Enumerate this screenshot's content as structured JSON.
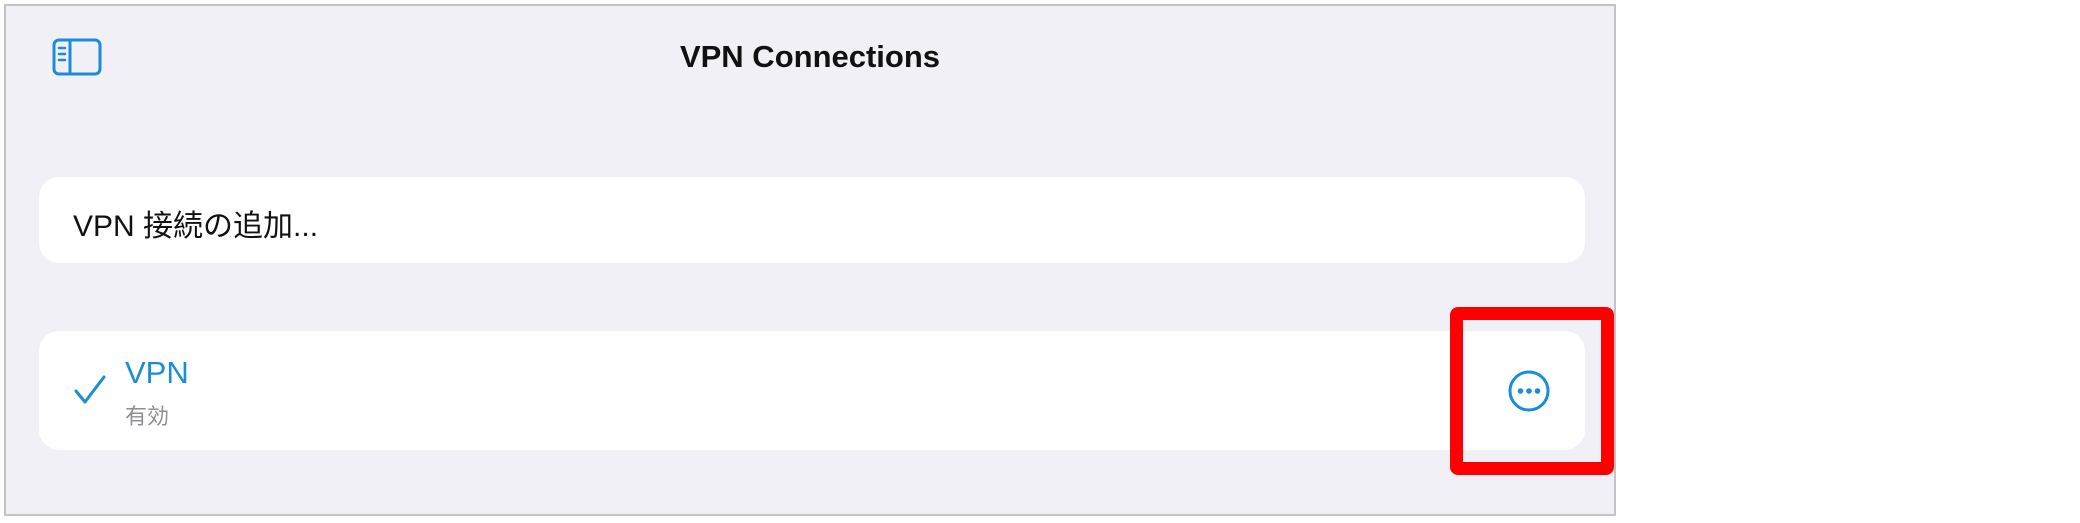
{
  "header": {
    "title": "VPN Connections",
    "sidebar_icon": "sidebar-toggle-icon"
  },
  "add_connection": {
    "label": "VPN 接続の追加..."
  },
  "vpn_item": {
    "name": "VPN",
    "status": "有効",
    "selected_icon": "checkmark-icon",
    "more_icon": "ellipsis-circle-icon"
  },
  "colors": {
    "accent": "#1a8cd8",
    "background": "#f1f0f6",
    "card": "#ffffff",
    "highlight": "#ff0000"
  }
}
